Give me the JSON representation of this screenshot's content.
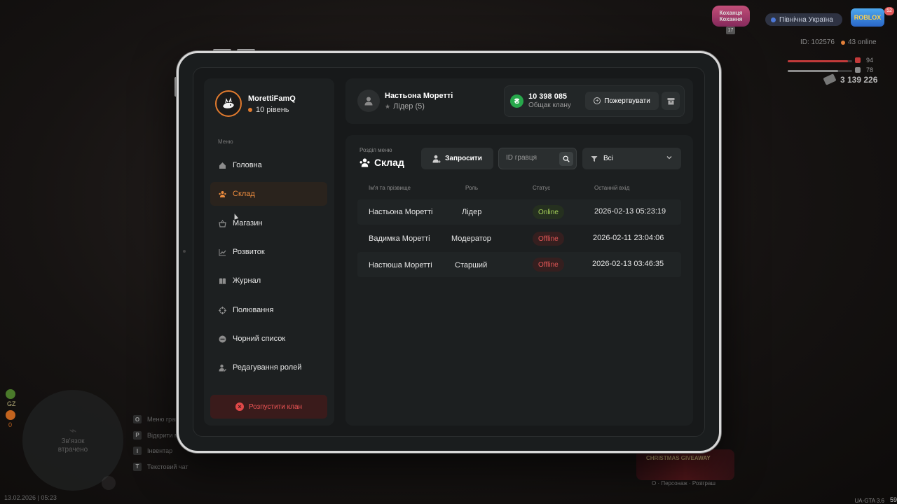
{
  "hud": {
    "logo_left_text": "Коханця Кохання",
    "logo_left_badge": "17",
    "server_name": "Північна Україна",
    "logo_right_text": "ROBLOX",
    "logo_right_badge": "52",
    "player_id": "ID: 102576",
    "online": "43 online",
    "health_value": "94",
    "armor_value": "78",
    "health_level": 0.94,
    "armor_level": 0.78,
    "money": "3 139 226",
    "left_labels": [
      "GZ",
      "0"
    ],
    "map_text": "Зв'язок втрачено",
    "keys": [
      {
        "key": "O",
        "label": "Меню гравця"
      },
      {
        "key": "P",
        "label": "Відкрити меню"
      },
      {
        "key": "I",
        "label": "Інвентар"
      },
      {
        "key": "T",
        "label": "Текстовий чат"
      }
    ],
    "datetime": "13.02.2026 | 05:23",
    "event_title": "CHRISTMAS GIVEAWAY",
    "event_sub": "О · Персонаж · Розіграш",
    "version": "UA-GTA 3.6",
    "fps": "59"
  },
  "profile": {
    "name": "MorettiFamQ",
    "level": "10 рівень"
  },
  "menu": {
    "caption": "Меню",
    "items": [
      {
        "label": "Головна",
        "icon": "home-icon"
      },
      {
        "label": "Склад",
        "icon": "people-icon"
      },
      {
        "label": "Магазин",
        "icon": "basket-icon"
      },
      {
        "label": "Розвиток",
        "icon": "chart-icon"
      },
      {
        "label": "Журнал",
        "icon": "book-icon"
      },
      {
        "label": "Полювання",
        "icon": "crosshair-icon"
      },
      {
        "label": "Чорний список",
        "icon": "ban-icon"
      },
      {
        "label": "Редагування ролей",
        "icon": "user-edit-icon"
      }
    ],
    "active": "Склад",
    "disband_label": "Розпустити клан"
  },
  "user": {
    "name": "Настьона Моретті",
    "role": "Лідер (5)"
  },
  "bank": {
    "currency_symbol": "₴",
    "amount": "10 398 085",
    "caption": "Общак клану",
    "donate_label": "Пожертвувати"
  },
  "section": {
    "caption": "Розділ меню",
    "title": "Склад",
    "invite_label": "Запросити",
    "search_placeholder": "ID гравця",
    "filter_label": "Всі"
  },
  "table": {
    "headers": [
      "Ім'я та прізвище",
      "Роль",
      "Статус",
      "Останній вхід"
    ],
    "rows": [
      {
        "name": "Настьона Моретті",
        "role": "Лідер",
        "status": "Online",
        "last_login": "2026-02-13 05:23:19"
      },
      {
        "name": "Вадимка Моретті",
        "role": "Модератор",
        "status": "Offline",
        "last_login": "2026-02-11 23:04:06"
      },
      {
        "name": "Настюша Моретті",
        "role": "Старший",
        "status": "Offline",
        "last_login": "2026-02-13 03:46:35"
      }
    ]
  },
  "colors": {
    "accent": "#e98a3e",
    "online": "#a7d25a",
    "offline": "#e25656",
    "bank_green": "#27a84b"
  }
}
